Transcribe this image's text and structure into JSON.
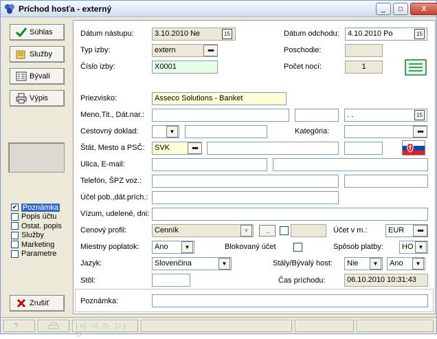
{
  "window": {
    "title": "Príchod hosťa - externý",
    "minimize": "_",
    "maximize": "□",
    "close": "X"
  },
  "sidebar": {
    "buttons": [
      {
        "label": "Súhlas",
        "icon": "checkmark-icon"
      },
      {
        "label": "Služby",
        "icon": "services-icon"
      },
      {
        "label": "Bývalí",
        "icon": "list-icon"
      },
      {
        "label": "Výpis",
        "icon": "printer-icon"
      }
    ],
    "checkboxes": [
      {
        "label": "Poznámka",
        "checked": true,
        "selected": true
      },
      {
        "label": "Popis účtu",
        "checked": false
      },
      {
        "label": "Ostat. popis",
        "checked": false
      },
      {
        "label": "Služby",
        "checked": false
      },
      {
        "label": "Marketing",
        "checked": false
      },
      {
        "label": "Parametre",
        "checked": false
      }
    ],
    "cancel": "Zrušiť"
  },
  "form": {
    "datum_nastupu": {
      "label": "Dátum nástupu:",
      "value": "3.10.2010  Ne"
    },
    "datum_odchodu": {
      "label": "Dátum odchodu:",
      "value": "4.10.2010  Po"
    },
    "typ_izby": {
      "label": "Typ izby:",
      "value": "extern"
    },
    "poschodie": {
      "label": "Poschodie:",
      "value": ""
    },
    "cislo_izby": {
      "label": "Číslo izby:",
      "value": "X0001"
    },
    "pocet_noci": {
      "label": "Počet nocí:",
      "value": "1"
    },
    "priezvisko": {
      "label": "Priezvisko:",
      "value": "Asseco Solutions - Banket"
    },
    "meno": {
      "label": "Meno,Tit., Dát.nar.:",
      "value": "",
      "title": "",
      "date": " .  . "
    },
    "cestovny_doklad": {
      "label": "Cestovný doklad:",
      "type": "",
      "number": ""
    },
    "kategoria": {
      "label": "Kategória:",
      "value": ""
    },
    "stat": {
      "label": "Štát, Mesto a PSČ:",
      "value": "SVK",
      "city": "",
      "psc": ""
    },
    "ulica": {
      "label": "Ulica, E-mail:",
      "value": "",
      "email": ""
    },
    "telefon": {
      "label": "Telefón, ŠPZ voz.:",
      "value": "",
      "spz": ""
    },
    "ucel": {
      "label": "Účel pob.,dát.prích.:",
      "value": ""
    },
    "vizum": {
      "label": "Vízum, udelené, dni:",
      "value": ""
    },
    "cenovy_profil": {
      "label": "Cenový profil:",
      "value": "Cenník"
    },
    "ucet_v_m": {
      "label": "Účet v m.:",
      "value": "EUR"
    },
    "miestny_poplatok": {
      "label": "Miestny poplatok:",
      "value": "Ano"
    },
    "blokovany_ucet": {
      "label": "Blokovaný účet"
    },
    "sposob_platby": {
      "label": "Spôsob platby:",
      "value": "HO"
    },
    "jazyk": {
      "label": "Jazyk:",
      "value": "Slovenčina"
    },
    "staly_byvaly": {
      "label": "Stály/Bývalý host:",
      "staly": "Nie",
      "byvaly": "Ano"
    },
    "stol": {
      "label": "Stôl:",
      "value": ""
    },
    "cas_prichodu": {
      "label": "Čas príchodu:",
      "value": "06.10.2010 10:31:43"
    },
    "poznamka": {
      "label": "Poznámka:",
      "value": ""
    }
  },
  "glyphs": {
    "ellipsis": "•••",
    "dots": "...",
    "dropdown": "▼",
    "calendar": "15",
    "check": "✔"
  },
  "colors": {
    "green_field": "#e6ffe6",
    "yellow_field": "#ffffd7",
    "selection": "#316ac5"
  }
}
